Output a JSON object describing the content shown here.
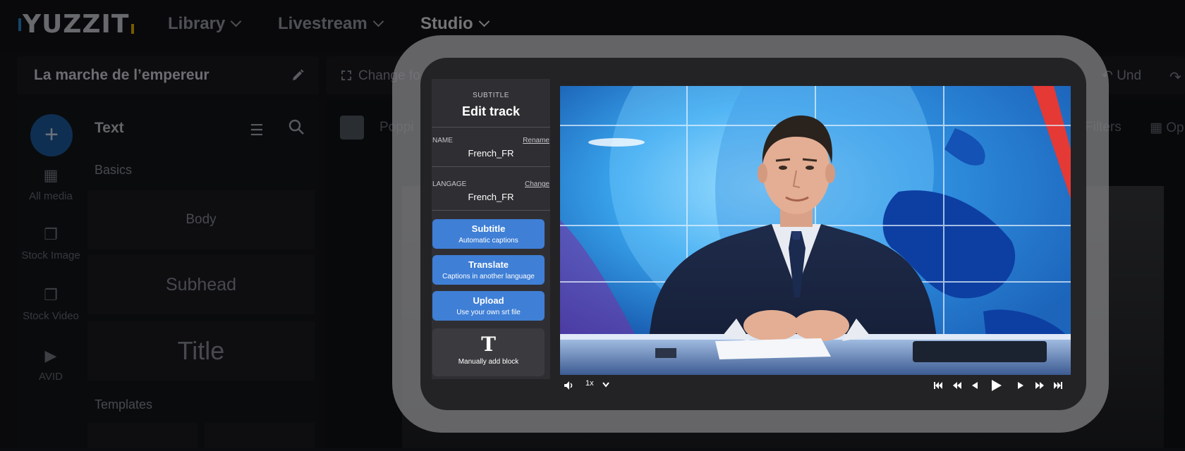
{
  "app": {
    "logo": "YUZZIT",
    "nav": [
      {
        "label": "Library"
      },
      {
        "label": "Livestream"
      },
      {
        "label": "Studio"
      }
    ],
    "project_title": "La marche de l’empereur",
    "toolbar": {
      "change_format": "Change fo",
      "undo": "Und"
    },
    "rail": [
      {
        "label": "All media",
        "icon": "grid-icon"
      },
      {
        "label": "Stock Image",
        "icon": "stock-image-icon"
      },
      {
        "label": "Stock Video",
        "icon": "stock-video-icon"
      },
      {
        "label": "AVID",
        "icon": "avid-icon"
      }
    ],
    "text_panel": {
      "title": "Text",
      "section_basics": "Basics",
      "cards": {
        "body": "Body",
        "subhead": "Subhead",
        "title": "Title"
      },
      "section_templates": "Templates"
    },
    "canvas": {
      "font": "Poppi",
      "filters": "Filters",
      "opacity": "Op"
    }
  },
  "modal": {
    "kicker": "SUBTITLE",
    "heading": "Edit track",
    "name_label": "NAME",
    "rename_link": "Rename",
    "name_value": "French_FR",
    "language_label": "LANGAGE",
    "change_link": "Change",
    "language_value": "French_FR",
    "buttons": {
      "subtitle_title": "Subtitle",
      "subtitle_sub": "Automatic captions",
      "translate_title": "Translate",
      "translate_sub": "Captions in another language",
      "upload_title": "Upload",
      "upload_sub": "Use your own srt file",
      "manual_glyph": "T",
      "manual_sub": "Manually add block"
    },
    "player": {
      "speed": "1x",
      "icons": [
        "volume-icon",
        "speed-chevron-icon",
        "skip-start-icon",
        "rewind-icon",
        "step-back-icon",
        "play-icon",
        "step-forward-icon",
        "fast-forward-icon",
        "skip-end-icon"
      ]
    },
    "colors": {
      "accent_blue": "#3f7fd6",
      "panel": "#2f2f33",
      "frame": "#7d7d80"
    }
  }
}
